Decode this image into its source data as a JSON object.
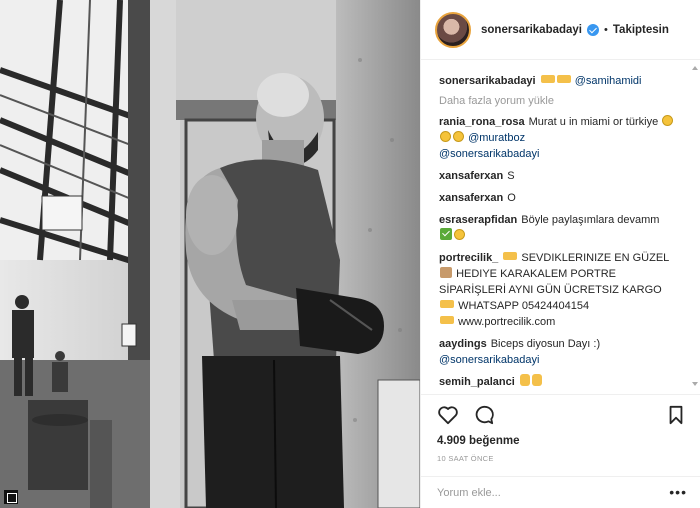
{
  "post": {
    "username": "sonersarikabadayi",
    "follow_label": "Takiptesin",
    "separator": "•"
  },
  "caption": {
    "username": "sonersarikabadayi",
    "mention": "@samihamidi"
  },
  "load_more": "Daha fazla yorum yükle",
  "comments": [
    {
      "username": "rania_rona_rosa",
      "text": "Murat u in miami or türkiye",
      "mention": "@muratboz",
      "mention2": "@sonersarikabadayi"
    },
    {
      "username": "xansaferxan",
      "text": "S"
    },
    {
      "username": "xansaferxan",
      "text": "O"
    },
    {
      "username": "esraserapfidan",
      "text": "Böyle paylaşımlara devamm"
    },
    {
      "username": "portrecilik_",
      "line1": "SEVDIKLERINIZE EN GÜZEL",
      "line2": "HEDIYE KARAKALEM PORTRE",
      "line3": "SİPARİŞLERİ AYNI GÜN ÜCRETSIZ KARGO",
      "line4": "WHATSAPP 05424404154",
      "line5": "www.portrecilik.com"
    },
    {
      "username": "aaydings",
      "text": "Biceps diyosun Dayı :)",
      "mention": "@sonersarikabadayi"
    },
    {
      "username": "semih_palanci",
      "text": ""
    }
  ],
  "actions": {
    "like_icon": "heart-outline-icon",
    "comment_icon": "speech-bubble-icon",
    "bookmark_icon": "bookmark-outline-icon"
  },
  "likes": "4.909 beğenme",
  "timestamp": "10 SAAT ÖNCE",
  "add_comment": {
    "placeholder": "Yorum ekle..."
  },
  "colors": {
    "verified": "#3897f0",
    "link": "#003569",
    "muted": "#999999",
    "border": "#efefef"
  }
}
